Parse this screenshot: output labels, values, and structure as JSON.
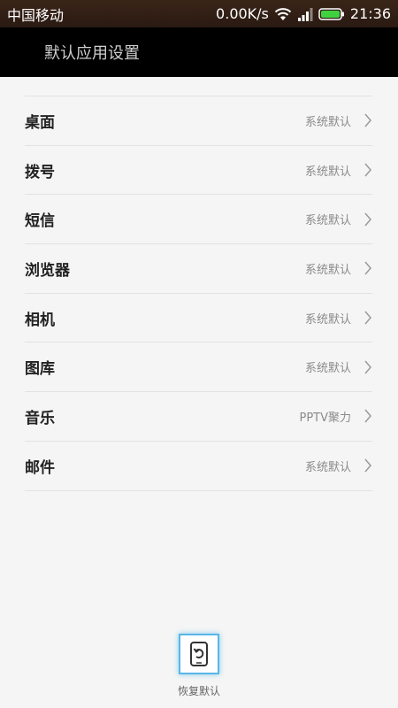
{
  "status_bar": {
    "carrier": "中国移动",
    "speed": "0.00K/s",
    "time": "21:36",
    "icons": [
      "wifi-icon",
      "signal-icon",
      "battery-icon"
    ],
    "battery_color": "#3fd13f"
  },
  "header": {
    "title": "默认应用设置"
  },
  "list": {
    "items": [
      {
        "label": "桌面",
        "value": "系统默认"
      },
      {
        "label": "拨号",
        "value": "系统默认"
      },
      {
        "label": "短信",
        "value": "系统默认"
      },
      {
        "label": "浏览器",
        "value": "系统默认"
      },
      {
        "label": "相机",
        "value": "系统默认"
      },
      {
        "label": "图库",
        "value": "系统默认"
      },
      {
        "label": "音乐",
        "value": "PPTV聚力"
      },
      {
        "label": "邮件",
        "value": "系统默认"
      }
    ]
  },
  "restore": {
    "label": "恢复默认",
    "accent": "#58b6e8"
  }
}
